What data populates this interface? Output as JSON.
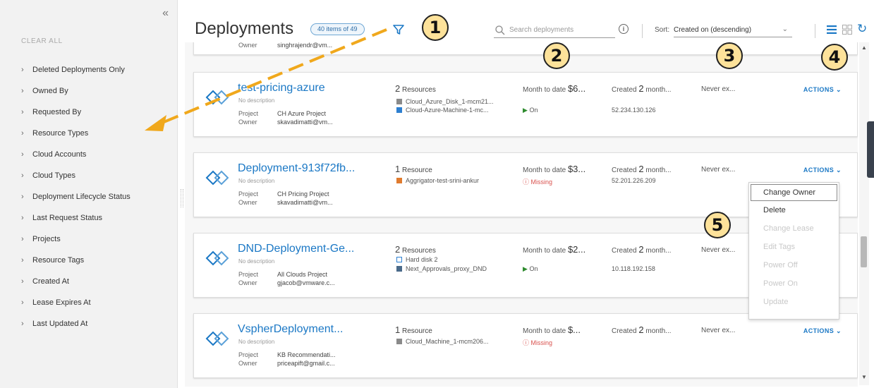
{
  "sidebar": {
    "clear_all": "CLEAR ALL",
    "filters": [
      "Deleted Deployments Only",
      "Owned By",
      "Requested By",
      "Resource Types",
      "Cloud Accounts",
      "Cloud Types",
      "Deployment Lifecycle Status",
      "Last Request Status",
      "Projects",
      "Resource Tags",
      "Created At",
      "Lease Expires At",
      "Last Updated At"
    ]
  },
  "header": {
    "title": "Deployments",
    "count": "40 items of 49",
    "search_placeholder": "Search deployments",
    "sort_label": "Sort:",
    "sort_value": "Created on (descending)"
  },
  "partial_card": {
    "owner_label": "Owner",
    "owner_value": "singhrajendr@vm..."
  },
  "deployments": [
    {
      "name": "test-pricing-azure",
      "description": "No description",
      "project_label": "Project",
      "project": "CH Azure Project",
      "owner_label": "Owner",
      "owner": "skavadimatti@vm...",
      "resource_count": "2",
      "resource_word": "Resources",
      "resources": [
        "Cloud_Azure_Disk_1-mcm21...",
        "Cloud-Azure-Machine-1-mc..."
      ],
      "mtd_label": "Month to date",
      "mtd_value": "$6...",
      "status": "On",
      "created_label": "Created",
      "created_value": "2",
      "created_unit": "month...",
      "ip": "52.234.130.126",
      "expires": "Never ex...",
      "actions": "ACTIONS"
    },
    {
      "name": "Deployment-913f72fb...",
      "description": "No description",
      "project_label": "Project",
      "project": "CH Pricing Project",
      "owner_label": "Owner",
      "owner": "skavadimatti@vm...",
      "resource_count": "1",
      "resource_word": "Resource",
      "resources": [
        "Aggrigator-test-srini-ankur"
      ],
      "mtd_label": "Month to date",
      "mtd_value": "$3...",
      "status": "Missing",
      "created_label": "Created",
      "created_value": "2",
      "created_unit": "month...",
      "ip": "52.201.226.209",
      "expires": "Never ex...",
      "actions": "ACTIONS"
    },
    {
      "name": "DND-Deployment-Ge...",
      "description": "No description",
      "project_label": "Project",
      "project": "All Clouds Project",
      "owner_label": "Owner",
      "owner": "gjacob@vmware.c...",
      "resource_count": "2",
      "resource_word": "Resources",
      "resources": [
        "Hard disk 2",
        "Next_Approvals_proxy_DND"
      ],
      "mtd_label": "Month to date",
      "mtd_value": "$2...",
      "status": "On",
      "created_label": "Created",
      "created_value": "2",
      "created_unit": "month...",
      "ip": "10.118.192.158",
      "expires": "Never ex...",
      "actions": ""
    },
    {
      "name": "VspherDeployment...",
      "description": "No description",
      "project_label": "Project",
      "project": "KB Recommendati...",
      "owner_label": "Owner",
      "owner": "priceapift@gmail.c...",
      "resource_count": "1",
      "resource_word": "Resource",
      "resources": [
        "Cloud_Machine_1-mcm206..."
      ],
      "mtd_label": "Month to date",
      "mtd_value": "$...",
      "status": "Missing",
      "created_label": "Created",
      "created_value": "2",
      "created_unit": "month...",
      "ip": "",
      "expires": "Never ex...",
      "actions": "ACTIONS"
    }
  ],
  "actions_menu": [
    "Change Owner",
    "Delete",
    "Change Lease",
    "Edit Tags",
    "Power Off",
    "Power On",
    "Update"
  ],
  "annotations": [
    "1",
    "2",
    "3",
    "4",
    "5"
  ],
  "colors": {
    "accent": "#1b78c5",
    "on": "#2e8b2e",
    "missing": "#d9534f",
    "annotation": "#fde29a",
    "arrow": "#f0a81c"
  }
}
